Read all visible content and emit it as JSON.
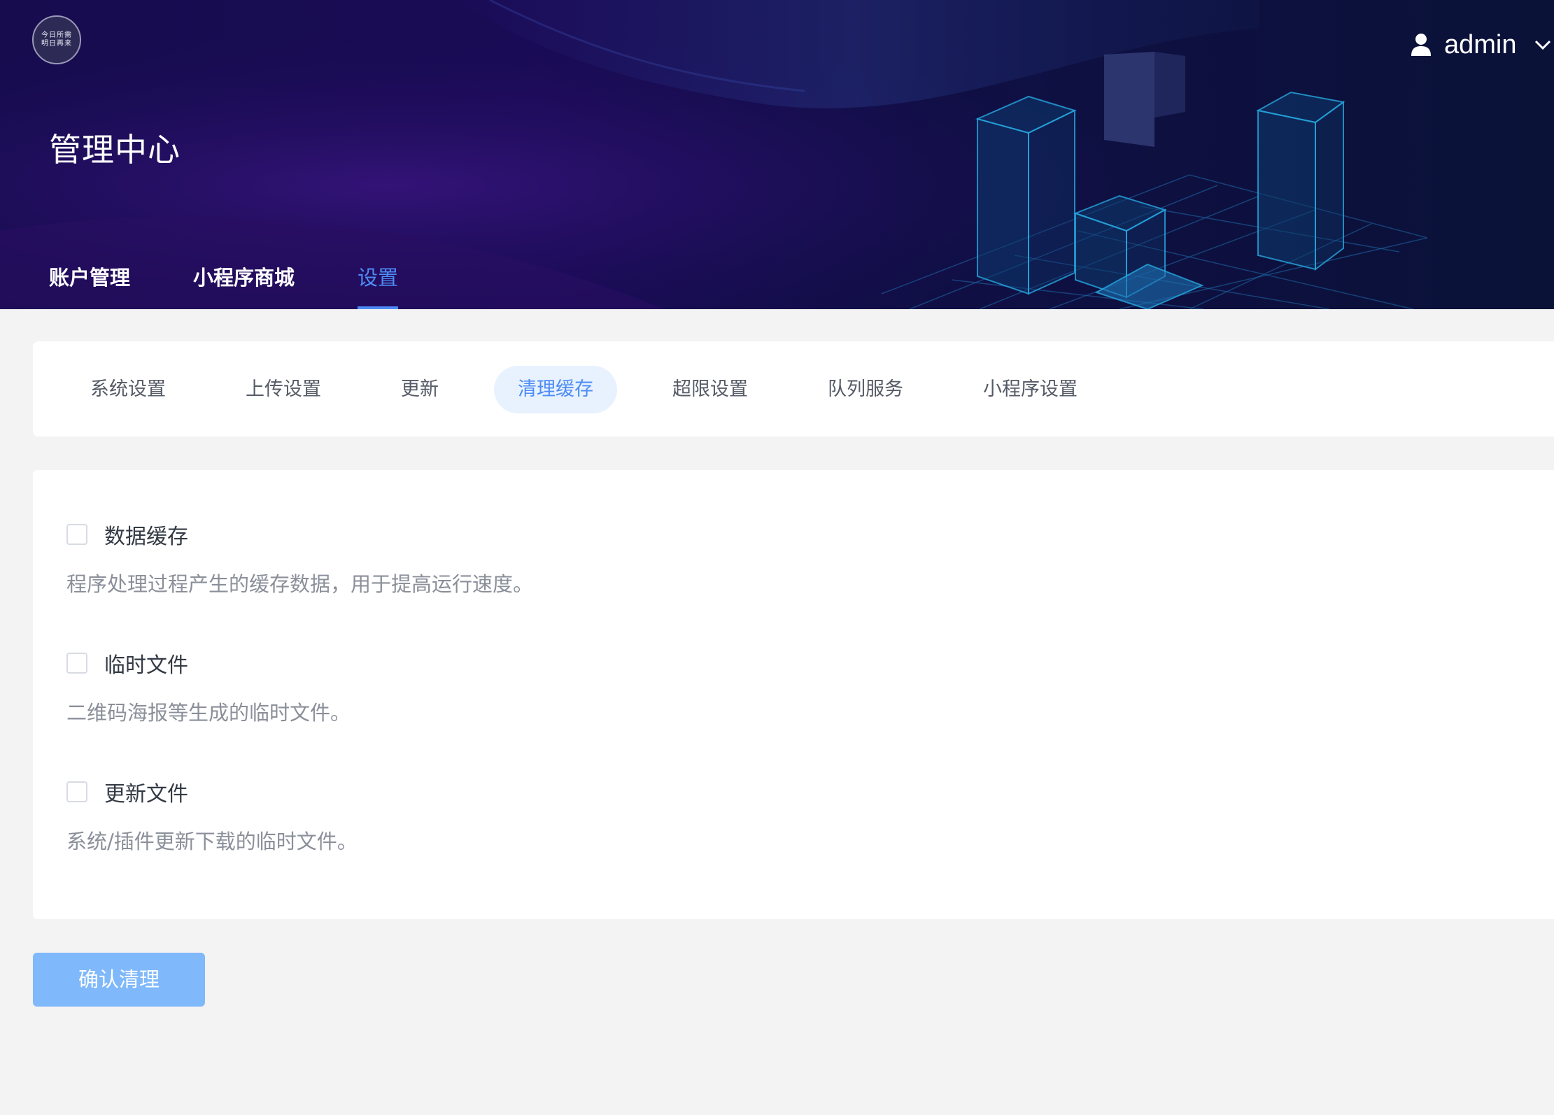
{
  "logo": {
    "line1": "今日所需",
    "line2": "明日再来"
  },
  "user": {
    "name": "admin"
  },
  "header": {
    "title": "管理中心"
  },
  "nav": [
    {
      "label": "账户管理",
      "active": false
    },
    {
      "label": "小程序商城",
      "active": false
    },
    {
      "label": "设置",
      "active": true
    }
  ],
  "tabs": [
    {
      "label": "系统设置",
      "active": false
    },
    {
      "label": "上传设置",
      "active": false
    },
    {
      "label": "更新",
      "active": false
    },
    {
      "label": "清理缓存",
      "active": true
    },
    {
      "label": "超限设置",
      "active": false
    },
    {
      "label": "队列服务",
      "active": false
    },
    {
      "label": "小程序设置",
      "active": false
    }
  ],
  "options": [
    {
      "label": "数据缓存",
      "checked": false,
      "desc": "程序处理过程产生的缓存数据，用于提高运行速度。"
    },
    {
      "label": "临时文件",
      "checked": false,
      "desc": "二维码海报等生成的临时文件。"
    },
    {
      "label": "更新文件",
      "checked": false,
      "desc": "系统/插件更新下载的临时文件。"
    }
  ],
  "confirm_button": {
    "label": "确认清理"
  },
  "colors": {
    "accent": "#4d8cf6",
    "button": "#7fb8fb",
    "tab_active_bg": "#e8f2ff",
    "header_bg": "#160c4e"
  }
}
